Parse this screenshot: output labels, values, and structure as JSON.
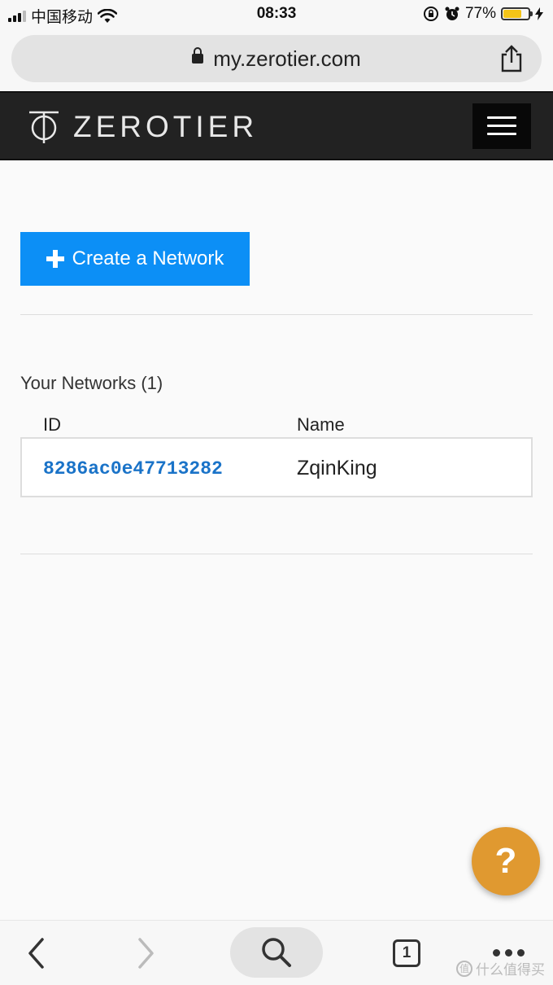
{
  "status_bar": {
    "carrier": "中国移动",
    "time": "08:33",
    "battery_percent": "77%",
    "battery_level": 0.77,
    "battery_color": "#f5c518"
  },
  "browser": {
    "url": "my.zerotier.com",
    "lock_icon": "lock-icon",
    "share_icon": "share-icon"
  },
  "header": {
    "logo_text": "ZEROTIER",
    "menu_icon": "hamburger-menu-icon",
    "background": "#222222"
  },
  "main": {
    "create_button_label": "Create a Network",
    "create_button_color": "#0c8ff6",
    "networks_title": "Your Networks (1)",
    "columns": {
      "id": "ID",
      "name": "Name"
    },
    "networks": [
      {
        "id": "8286ac0e47713282",
        "name": "ZqinKing"
      }
    ]
  },
  "help_button": {
    "label": "?",
    "color": "#e09930"
  },
  "toolbar": {
    "back_icon": "chevron-left-icon",
    "forward_icon": "chevron-right-icon",
    "search_icon": "search-icon",
    "tab_count": "1",
    "more_icon": "more-dots-icon"
  },
  "watermark": {
    "text": "什么值得买",
    "icon_text": "值"
  }
}
